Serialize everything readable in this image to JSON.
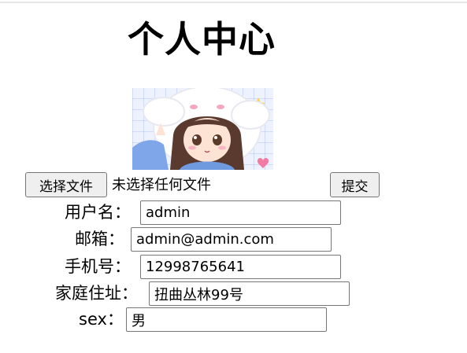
{
  "page": {
    "title": "个人中心"
  },
  "upload": {
    "choose_file_label": "选择文件",
    "no_file_text": "未选择任何文件",
    "submit_label": "提交"
  },
  "form": {
    "username": {
      "label": "用户名：",
      "value": "admin"
    },
    "email": {
      "label": "邮箱：",
      "value": "admin@admin.com"
    },
    "phone": {
      "label": "手机号：",
      "value": "12998765641"
    },
    "address": {
      "label": "家庭住址：",
      "value": "扭曲丛林99号"
    },
    "sex": {
      "label": "sex：",
      "value": "男"
    }
  }
}
